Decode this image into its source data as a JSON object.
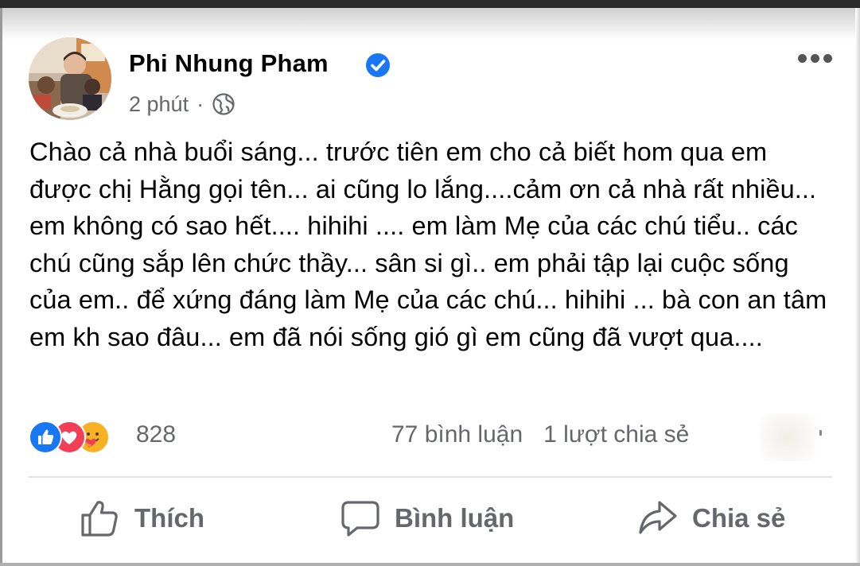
{
  "post": {
    "author": "Phi Nhung Pham",
    "verified": true,
    "time": "2 phút",
    "separator": "·",
    "privacy_icon": "globe-icon",
    "more_icon": "more-options-icon",
    "text": "Chào cả nhà buổi sáng... trước tiên em cho cả biết hom qua em được chị Hằng gọi tên... ai cũng lo lắng....cảm ơn cả nhà rất nhiều... em không có sao hết.... hihihi .... em làm Mẹ của các chú tiểu.. các chú cũng sắp lên chức thầy... sân si gì.. em phải tập lại cuộc sống của em.. để xứng đáng làm Mẹ của các chú... hihihi ... bà con an tâm em kh sao đâu... em đã nói sống gió gì em cũng đã vượt qua...."
  },
  "stats": {
    "reaction_icons": [
      "like-reaction-icon",
      "love-reaction-icon",
      "care-reaction-icon"
    ],
    "reaction_count": "828",
    "comments": "77 bình luận",
    "shares": "1 lượt chia sẻ"
  },
  "actions": {
    "like": "Thích",
    "comment": "Bình luận",
    "share": "Chia sẻ"
  },
  "colors": {
    "text": "#050505",
    "secondary": "#65676b",
    "facebook_blue": "#1877f2",
    "love_red": "#f33e58",
    "care_yellow": "#f7b125"
  }
}
